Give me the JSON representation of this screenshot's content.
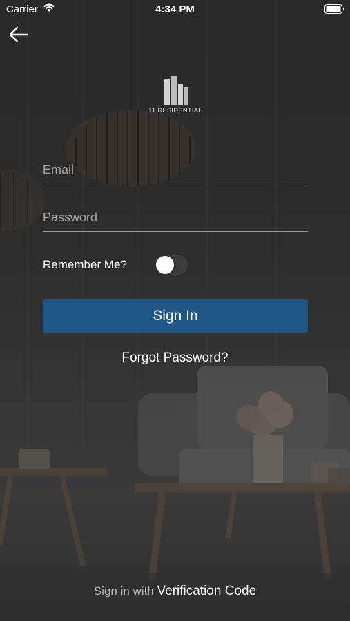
{
  "status_bar": {
    "carrier": "Carrier",
    "time": "4:34 PM"
  },
  "nav": {
    "back_icon": "arrow-left-icon"
  },
  "logo": {
    "text": "11 RESIDENTIAL"
  },
  "form": {
    "email_placeholder": "Email",
    "password_placeholder": "Password",
    "remember_label": "Remember Me?",
    "remember_on": false,
    "sign_in_label": "Sign In",
    "forgot_label": "Forgot Password?"
  },
  "footer": {
    "prefix": "Sign in with",
    "link": "Verification Code"
  },
  "colors": {
    "primary_button": "#1f5788",
    "text": "#ffffff",
    "placeholder": "#a8a8a8"
  }
}
